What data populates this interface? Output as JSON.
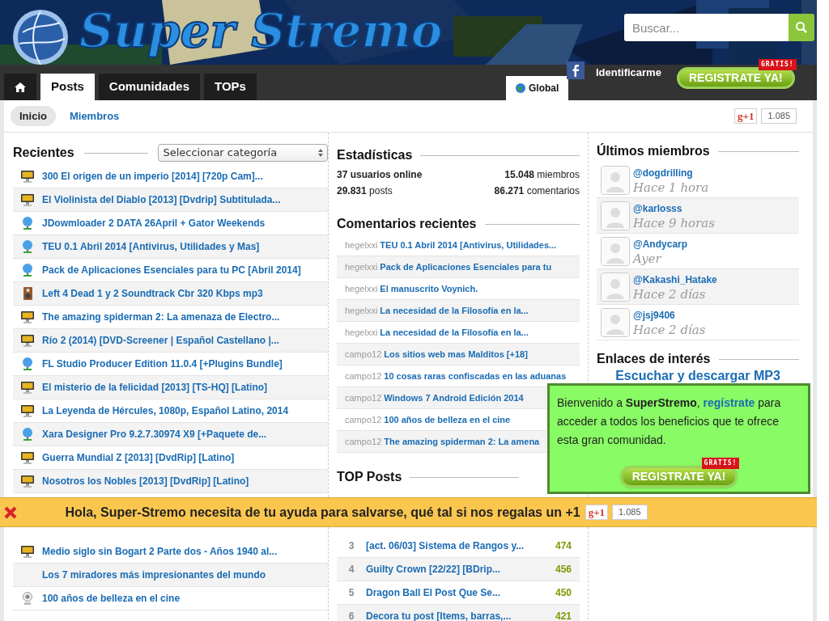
{
  "header": {
    "logo": "Super Stremo",
    "search": {
      "placeholder": "Buscar..."
    },
    "login": "Identificarme",
    "register": {
      "label": "REGISTRATE YA!",
      "badge": "GRATIS!"
    }
  },
  "tabs": [
    {
      "kind": "home",
      "selected": false
    },
    {
      "kind": "text",
      "label": "Posts",
      "selected": true
    },
    {
      "kind": "text",
      "label": "Comunidades",
      "selected": false
    },
    {
      "kind": "text",
      "label": "TOPs",
      "selected": false
    }
  ],
  "scope_tab": {
    "label": "Global",
    "selected": true
  },
  "subnav": [
    {
      "label": "Inicio",
      "selected": true
    },
    {
      "label": "Miembros",
      "selected": false
    }
  ],
  "plusone": {
    "label": "g+1",
    "count": "1.085"
  },
  "recientes": {
    "title": "Recientes",
    "category_select": "Seleccionar categoría",
    "posts": [
      {
        "kind": "movie",
        "title": "300 El origen de un imperio [2014] [720p Cam]..."
      },
      {
        "kind": "movie",
        "title": "El Violinista del Diablo [2013] [Dvdrip] Subtitulada..."
      },
      {
        "kind": "software",
        "title": "JDowmloader 2 DATA 26April + Gator Weekends"
      },
      {
        "kind": "software",
        "title": "TEU 0.1 Abril 2014 [Antivirus, Utilidades y Mas]"
      },
      {
        "kind": "software",
        "title": "Pack de Aplicaciones Esenciales para tu PC [Abril 2014]"
      },
      {
        "kind": "music",
        "title": "Left 4 Dead 1 y 2 Soundtrack Cbr 320 Kbps mp3"
      },
      {
        "kind": "movie",
        "title": "The amazing spiderman 2: La amenaza de Electro..."
      },
      {
        "kind": "movie",
        "title": "Río 2 (2014) [DVD-Screener | Español Castellano |..."
      },
      {
        "kind": "software",
        "title": "FL Studio Producer Edition 11.0.4 [+Plugins Bundle]"
      },
      {
        "kind": "movie",
        "title": "El misterio de la felicidad [2013] [TS-HQ] [Latino]"
      },
      {
        "kind": "movie",
        "title": "La Leyenda de Hércules, 1080p, Español Latino, 2014"
      },
      {
        "kind": "software",
        "title": "Xara Designer Pro 9.2.7.30974 X9 [+Paquete de..."
      },
      {
        "kind": "movie",
        "title": "Guerra Mundial Z [2013] [DvdRip] [Latino]"
      },
      {
        "kind": "movie",
        "title": "Nosotros los Nobles [2013] [DvdRip] [Latino]"
      }
    ],
    "posts_below_banner": [
      {
        "kind": "movie",
        "title": "Medio siglo sin Bogart 2 Parte dos - Años 1940 al..."
      },
      {
        "kind": "other",
        "title": "Los 7 miradores más impresionantes del mundo"
      },
      {
        "kind": "video",
        "title": "100 años de belleza en el cine"
      }
    ]
  },
  "stats": {
    "title": "Estadísticas",
    "online": "37 usuarios online",
    "members": "**15.048** miembros",
    "posts": "**29.831** posts",
    "comments": "**86.271** comentarios"
  },
  "comments": {
    "title": "Comentarios recientes",
    "items": [
      {
        "user": "hegelxxi",
        "post": "TEU 0.1 Abril 2014 [Antivirus, Utilidades..."
      },
      {
        "user": "hegelxxi",
        "post": "Pack de Aplicaciones Esenciales para tu"
      },
      {
        "user": "hegelxxi",
        "post": "El manuscrito Voynich."
      },
      {
        "user": "hegelxxi",
        "post": "La necesidad de la Filosofía en la..."
      },
      {
        "user": "hegelxxi",
        "post": "La necesidad de la Filosofía en la..."
      },
      {
        "user": "campo12",
        "post": "Los sitios web mas Malditos [+18]"
      },
      {
        "user": "campo12",
        "post": "10 cosas raras confiscadas en las aduanas"
      },
      {
        "user": "campo12",
        "post": "Windows 7 Android Edición 2014"
      },
      {
        "user": "campo12",
        "post": "100 años de belleza en el cine"
      },
      {
        "user": "campo12",
        "post": "The amazing spiderman 2: La amena"
      }
    ]
  },
  "top_posts": {
    "title": "TOP Posts",
    "items": [
      {
        "rank": "3",
        "title": "[act. 06/03] Sistema de Rangos y...",
        "points": "474"
      },
      {
        "rank": "4",
        "title": "Guilty Crown [22/22] [BDrip...",
        "points": "456"
      },
      {
        "rank": "5",
        "title": "Dragon Ball El Post Que Se...",
        "points": "450"
      },
      {
        "rank": "6",
        "title": "Decora tu post [Items, barras,...",
        "points": "421"
      }
    ]
  },
  "members": {
    "title": "Últimos miembros",
    "items": [
      {
        "handle": "@dogdrilling",
        "when": "Hace 1 hora"
      },
      {
        "handle": "@karlosss",
        "when": "Hace 9 horas"
      },
      {
        "handle": "@Andycarp",
        "when": "Ayer"
      },
      {
        "handle": "@Kakashi_Hatake",
        "when": "Hace 2 días"
      },
      {
        "handle": "@jsj9406",
        "when": "Hace 2 días"
      }
    ]
  },
  "links": {
    "title": "Enlaces de interés",
    "items": [
      "Escuchar y descargar MP3"
    ]
  },
  "welcome_popup": {
    "before": "Bienvenido a **SuperStremo**, ",
    "link": "regístrate",
    "after": " para acceder a todos los beneficios que te ofrece esta gran comunidad.",
    "register": {
      "label": "REGISTRATE YA!",
      "badge": "GRATIS!"
    }
  },
  "support_bar": {
    "message": "Hola, Super-Stremo necesita de tu ayuda para salvarse, qué tal si nos regalas un +1",
    "plusone": {
      "label": "g+1",
      "count": "1.085"
    }
  }
}
